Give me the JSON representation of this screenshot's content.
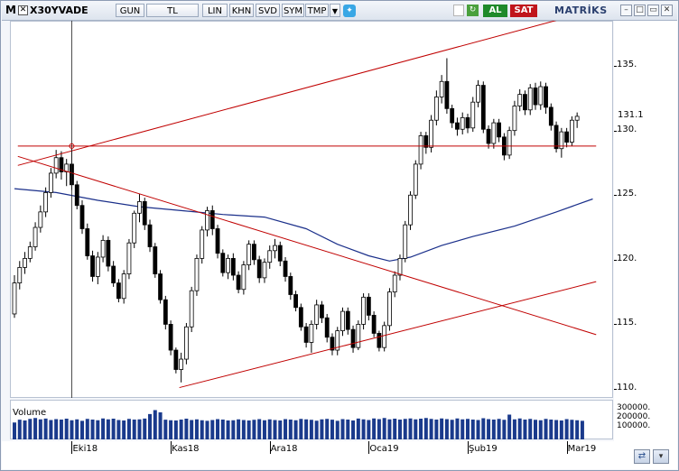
{
  "toolbar": {
    "m_label": "M",
    "symbol": "X30YVADE",
    "buttons": [
      "GUN",
      "TL",
      "LIN",
      "KHN",
      "SVD",
      "SYM",
      "TMP"
    ],
    "al_label": "AL",
    "sat_label": "SAT",
    "brand": "MATRİKS",
    "colors": {
      "al": "#1f8a2a",
      "sat": "#c0151b"
    }
  },
  "chart_data": {
    "type": "candlestick",
    "y_ticks": [
      "135.",
      "130.",
      "125.",
      "120.",
      "115.",
      "110."
    ],
    "last_price": "131.1",
    "x_ticks": [
      "Eki18",
      "Kas18",
      "Ara18",
      "Oca19",
      "Şub19",
      "Mar19"
    ],
    "volume_label": "Volume",
    "volume_ticks": [
      "300000.",
      "200000.",
      "100000."
    ],
    "ylim": [
      109.3,
      138.5
    ],
    "ohlc": [
      [
        115.8,
        118.8,
        115.5,
        118.2
      ],
      [
        118.2,
        119.9,
        117.7,
        119.4
      ],
      [
        119.4,
        120.6,
        118.9,
        120.1
      ],
      [
        120.1,
        121.4,
        119.8,
        121.0
      ],
      [
        121.0,
        122.9,
        120.7,
        122.5
      ],
      [
        122.5,
        124.2,
        122.1,
        123.7
      ],
      [
        123.7,
        125.6,
        123.3,
        125.2
      ],
      [
        125.2,
        127.1,
        124.8,
        126.7
      ],
      [
        126.7,
        128.5,
        126.3,
        127.9
      ],
      [
        127.9,
        128.4,
        126.2,
        126.8
      ],
      [
        126.8,
        127.8,
        125.7,
        127.4
      ],
      [
        127.4,
        128.6,
        125.4,
        125.8
      ],
      [
        125.8,
        126.1,
        123.9,
        124.2
      ],
      [
        124.2,
        124.6,
        122.0,
        122.4
      ],
      [
        122.4,
        122.8,
        120.0,
        120.3
      ],
      [
        120.3,
        120.7,
        118.3,
        118.7
      ],
      [
        118.7,
        120.6,
        118.1,
        120.2
      ],
      [
        120.2,
        121.9,
        119.8,
        121.5
      ],
      [
        121.5,
        121.8,
        119.1,
        119.5
      ],
      [
        119.5,
        119.9,
        117.9,
        118.2
      ],
      [
        118.2,
        118.5,
        116.7,
        117.0
      ],
      [
        117.0,
        119.2,
        116.6,
        118.9
      ],
      [
        118.9,
        121.6,
        118.5,
        121.3
      ],
      [
        121.3,
        123.8,
        120.9,
        123.6
      ],
      [
        123.6,
        125.1,
        122.9,
        124.5
      ],
      [
        124.5,
        124.8,
        122.3,
        122.7
      ],
      [
        122.7,
        123.1,
        120.6,
        121.0
      ],
      [
        121.0,
        121.3,
        118.6,
        118.9
      ],
      [
        118.9,
        119.2,
        116.6,
        116.9
      ],
      [
        116.9,
        117.2,
        114.6,
        115.0
      ],
      [
        115.0,
        115.3,
        112.6,
        113.0
      ],
      [
        113.0,
        113.2,
        111.2,
        111.5
      ],
      [
        111.5,
        112.8,
        110.5,
        112.3
      ],
      [
        112.3,
        115.1,
        111.9,
        114.8
      ],
      [
        114.8,
        117.9,
        114.4,
        117.6
      ],
      [
        117.6,
        120.4,
        117.2,
        120.1
      ],
      [
        120.1,
        122.6,
        119.7,
        122.3
      ],
      [
        122.3,
        124.1,
        121.8,
        123.8
      ],
      [
        123.8,
        124.2,
        121.9,
        122.4
      ],
      [
        122.4,
        122.7,
        120.1,
        120.5
      ],
      [
        120.5,
        120.8,
        118.7,
        119.0
      ],
      [
        119.0,
        120.4,
        118.5,
        120.1
      ],
      [
        120.1,
        120.5,
        118.4,
        118.8
      ],
      [
        118.8,
        119.1,
        117.4,
        117.7
      ],
      [
        117.7,
        119.9,
        117.3,
        119.6
      ],
      [
        119.6,
        121.5,
        119.2,
        121.2
      ],
      [
        121.2,
        121.5,
        119.6,
        120.0
      ],
      [
        120.0,
        120.3,
        118.2,
        118.6
      ],
      [
        118.6,
        120.1,
        118.2,
        119.8
      ],
      [
        119.8,
        121.1,
        119.3,
        120.7
      ],
      [
        120.7,
        121.6,
        120.1,
        121.1
      ],
      [
        121.1,
        121.4,
        119.5,
        119.9
      ],
      [
        119.9,
        120.2,
        118.3,
        118.7
      ],
      [
        118.7,
        119.0,
        116.9,
        117.3
      ],
      [
        117.3,
        117.6,
        116.0,
        116.3
      ],
      [
        116.3,
        116.6,
        114.5,
        114.8
      ],
      [
        114.8,
        115.1,
        113.2,
        113.6
      ],
      [
        113.6,
        115.3,
        112.8,
        115.0
      ],
      [
        115.0,
        116.9,
        114.6,
        116.5
      ],
      [
        116.5,
        116.8,
        115.1,
        115.5
      ],
      [
        115.5,
        115.8,
        113.6,
        114.0
      ],
      [
        114.0,
        114.3,
        112.6,
        113.0
      ],
      [
        113.0,
        114.8,
        112.6,
        114.5
      ],
      [
        114.5,
        116.3,
        114.1,
        116.0
      ],
      [
        116.0,
        116.3,
        114.2,
        114.6
      ],
      [
        114.6,
        114.9,
        112.8,
        113.2
      ],
      [
        113.2,
        115.3,
        113.0,
        115.0
      ],
      [
        115.0,
        117.4,
        114.6,
        117.1
      ],
      [
        117.1,
        117.4,
        115.3,
        115.7
      ],
      [
        115.7,
        116.0,
        114.0,
        114.3
      ],
      [
        114.3,
        114.5,
        112.9,
        113.2
      ],
      [
        113.2,
        115.2,
        112.9,
        114.9
      ],
      [
        114.9,
        117.8,
        114.5,
        117.5
      ],
      [
        117.5,
        119.1,
        117.1,
        118.8
      ],
      [
        118.8,
        120.4,
        118.4,
        120.1
      ],
      [
        120.1,
        123.0,
        119.8,
        122.7
      ],
      [
        122.7,
        125.3,
        122.3,
        125.0
      ],
      [
        125.0,
        127.7,
        124.7,
        127.4
      ],
      [
        127.4,
        129.9,
        127.0,
        129.6
      ],
      [
        129.6,
        129.9,
        128.2,
        128.7
      ],
      [
        128.7,
        131.2,
        128.3,
        130.8
      ],
      [
        130.8,
        133.1,
        130.4,
        132.6
      ],
      [
        132.6,
        134.3,
        132.1,
        133.8
      ],
      [
        133.8,
        135.6,
        131.3,
        131.7
      ],
      [
        131.7,
        132.0,
        130.2,
        130.6
      ],
      [
        130.6,
        131.0,
        129.6,
        130.1
      ],
      [
        130.1,
        131.4,
        129.7,
        131.0
      ],
      [
        131.0,
        131.3,
        129.8,
        130.2
      ],
      [
        130.2,
        132.6,
        129.9,
        132.2
      ],
      [
        132.2,
        133.9,
        131.8,
        133.5
      ],
      [
        133.5,
        133.8,
        129.8,
        130.1
      ],
      [
        130.1,
        130.4,
        128.6,
        129.0
      ],
      [
        129.0,
        130.9,
        128.6,
        130.6
      ],
      [
        130.6,
        130.9,
        129.1,
        129.5
      ],
      [
        129.5,
        129.8,
        127.7,
        128.1
      ],
      [
        128.1,
        130.3,
        127.8,
        130.0
      ],
      [
        130.0,
        132.3,
        129.6,
        131.9
      ],
      [
        131.9,
        133.2,
        131.5,
        132.8
      ],
      [
        132.8,
        133.1,
        131.2,
        131.6
      ],
      [
        131.6,
        133.6,
        131.2,
        133.3
      ],
      [
        133.3,
        133.7,
        131.6,
        132.0
      ],
      [
        132.0,
        133.8,
        131.6,
        133.4
      ],
      [
        133.4,
        133.7,
        131.3,
        131.8
      ],
      [
        131.8,
        132.1,
        130.0,
        130.4
      ],
      [
        130.4,
        130.7,
        128.3,
        128.6
      ],
      [
        128.6,
        130.2,
        127.9,
        129.9
      ],
      [
        129.9,
        130.2,
        128.7,
        129.1
      ],
      [
        129.1,
        131.1,
        128.8,
        130.8
      ],
      [
        130.8,
        131.4,
        130.2,
        131.1
      ]
    ],
    "volume": [
      150000,
      175000,
      168000,
      182000,
      190000,
      178000,
      185000,
      172000,
      180000,
      176000,
      184000,
      170000,
      178000,
      165000,
      182000,
      176000,
      170000,
      186000,
      178000,
      184000,
      172000,
      168000,
      182000,
      176000,
      178000,
      185000,
      225000,
      260000,
      240000,
      175000,
      170000,
      168000,
      176000,
      184000,
      172000,
      178000,
      170000,
      165000,
      172000,
      180000,
      176000,
      168000,
      170000,
      178000,
      172000,
      168000,
      174000,
      180000,
      170000,
      178000,
      172000,
      168000,
      180000,
      176000,
      170000,
      182000,
      178000,
      174000,
      166000,
      178000,
      182000,
      175000,
      165000,
      180000,
      176000,
      168000,
      185000,
      178000,
      172000,
      186000,
      180000,
      190000,
      178000,
      184000,
      176000,
      182000,
      186000,
      178000,
      184000,
      190000,
      182000,
      176000,
      186000,
      180000,
      174000,
      186000,
      178000,
      182000,
      176000,
      172000,
      188000,
      180000,
      176000,
      182000,
      174000,
      220000,
      178000,
      186000,
      176000,
      182000,
      174000,
      170000,
      182000,
      176000,
      172000,
      168000,
      180000,
      174000,
      170000,
      165000
    ],
    "moving_average": [
      [
        0,
        125.5
      ],
      [
        8,
        125.2
      ],
      [
        16,
        124.6
      ],
      [
        24,
        124.1
      ],
      [
        32,
        123.8
      ],
      [
        40,
        123.5
      ],
      [
        48,
        123.3
      ],
      [
        56,
        122.4
      ],
      [
        62,
        121.2
      ],
      [
        68,
        120.3
      ],
      [
        72,
        119.9
      ],
      [
        76,
        120.2
      ],
      [
        82,
        121.1
      ],
      [
        88,
        121.8
      ],
      [
        96,
        122.6
      ],
      [
        104,
        123.7
      ],
      [
        111,
        124.7
      ]
    ],
    "trend_lines": [
      {
        "from": [
          1,
          128.0
        ],
        "to": [
          112,
          114.2
        ],
        "color": "#c00000"
      },
      {
        "from": [
          1,
          127.3
        ],
        "to": [
          105,
          138.6
        ],
        "color": "#c00000"
      },
      {
        "from": [
          32,
          110.1
        ],
        "to": [
          112,
          118.3
        ],
        "color": "#c00000"
      },
      {
        "from": [
          1,
          128.8
        ],
        "to": [
          112,
          128.8
        ],
        "color": "#c00000"
      }
    ],
    "crosshair_index": 11,
    "grid": false
  }
}
